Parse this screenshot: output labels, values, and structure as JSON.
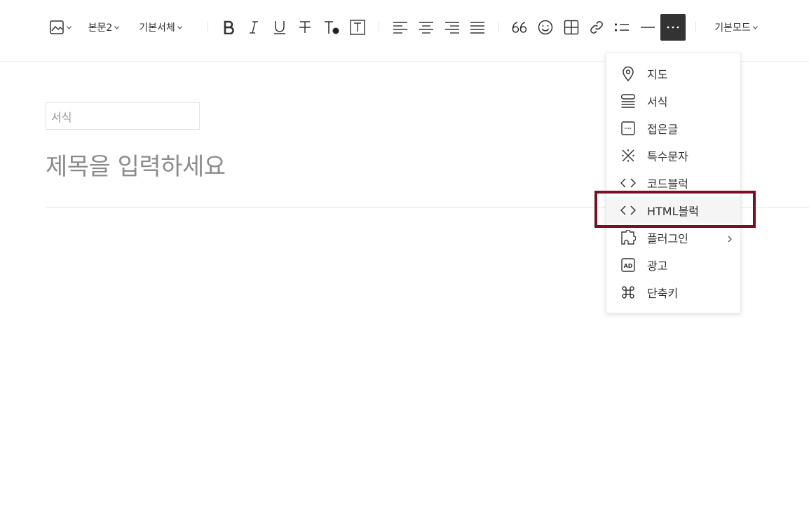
{
  "toolbar": {
    "paragraph_style": "본문2",
    "font_family": "기본서체",
    "mode": "기본모드",
    "more_label": "···"
  },
  "editor": {
    "category_placeholder": "서식",
    "title_placeholder": "제목을 입력하세요"
  },
  "more_menu": {
    "items": [
      {
        "label": "지도",
        "icon": "map-pin-icon"
      },
      {
        "label": "서식",
        "icon": "template-icon"
      },
      {
        "label": "접은글",
        "icon": "fold-icon"
      },
      {
        "label": "특수문자",
        "icon": "special-char-icon"
      },
      {
        "label": "코드블럭",
        "icon": "code-icon"
      },
      {
        "label": "HTML블럭",
        "icon": "code-icon"
      },
      {
        "label": "플러그인",
        "icon": "plugin-icon"
      },
      {
        "label": "광고",
        "icon": "ad-icon"
      },
      {
        "label": "단축키",
        "icon": "command-icon"
      }
    ],
    "highlighted_index": 5
  },
  "colors": {
    "highlight_border": "#7a0f24",
    "active_button_bg": "#333333",
    "placeholder_text": "#8c8c8c"
  }
}
